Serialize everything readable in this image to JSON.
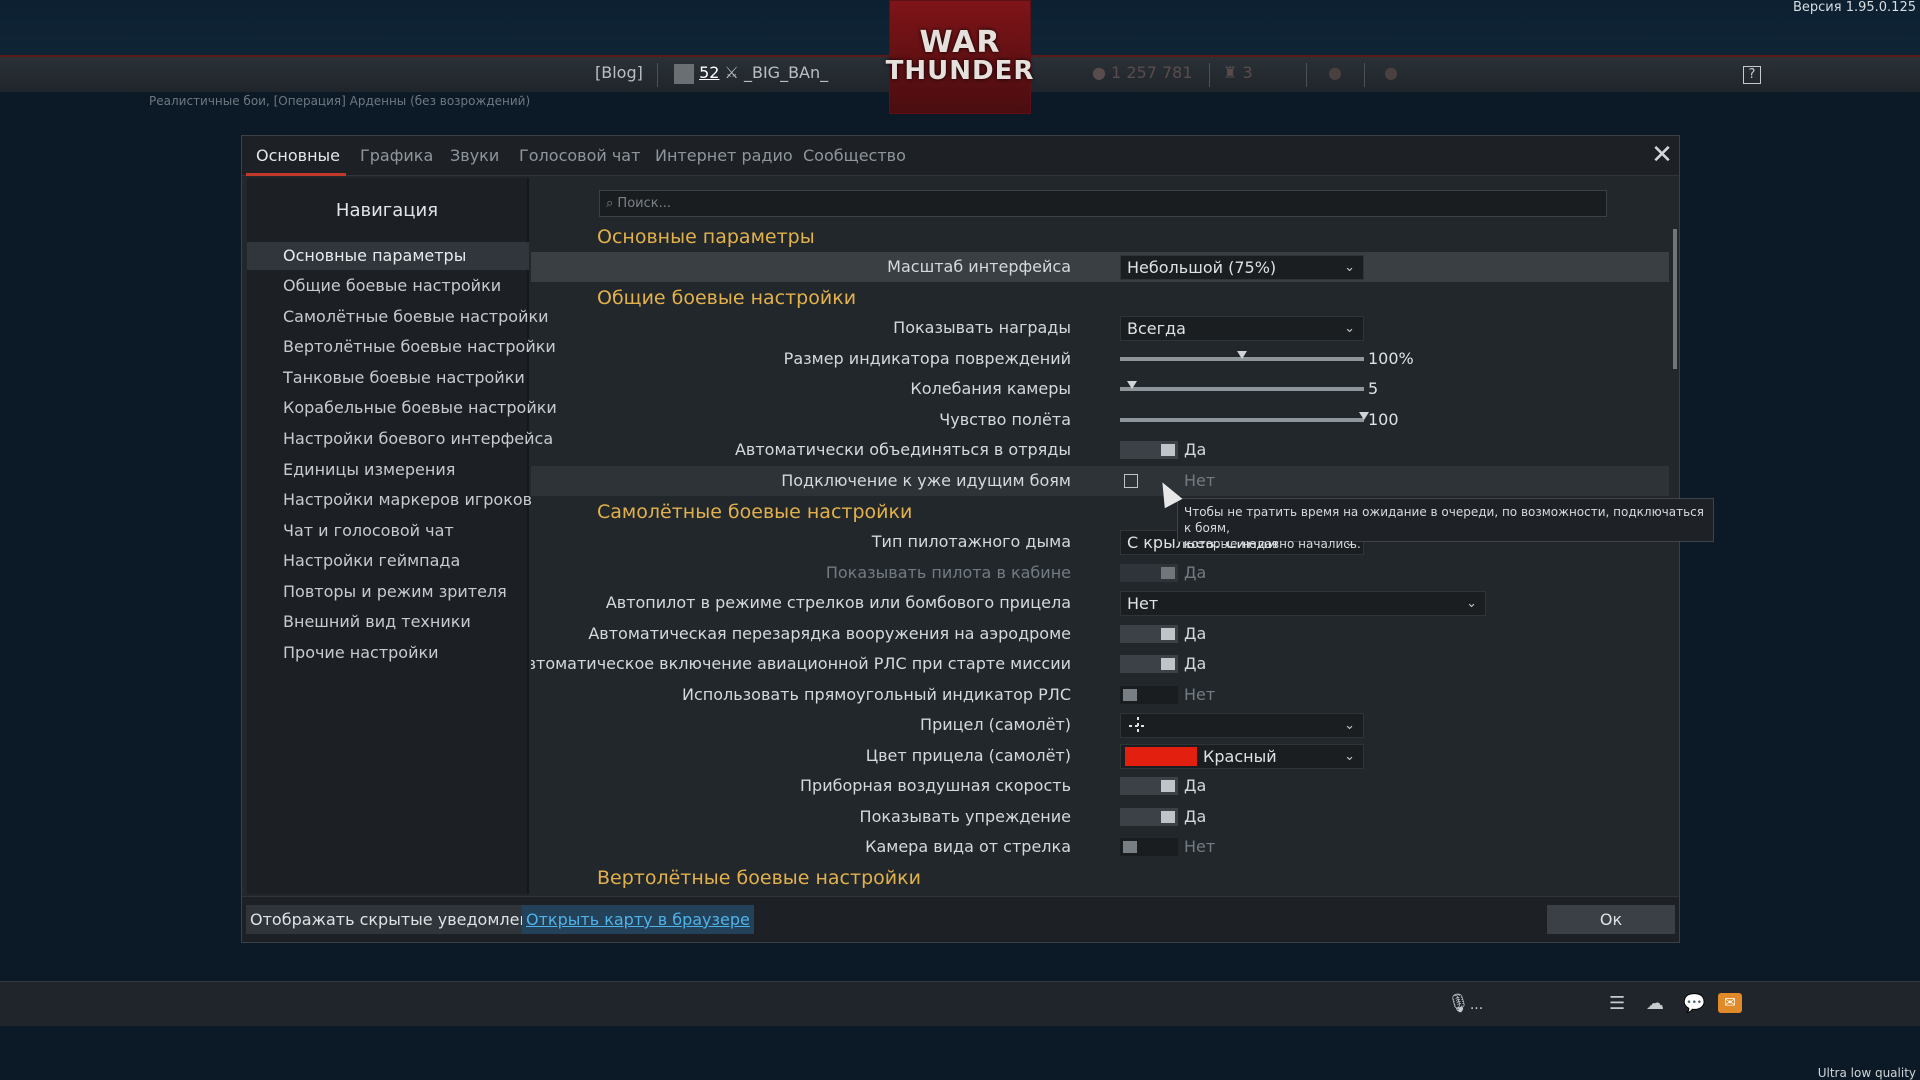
{
  "window": {
    "version": "Версия 1.95.0.125",
    "logo_line1": "WAR",
    "logo_line2": "THUNDER",
    "mission": "Реалистичные бои, [Операция] Арденны (без возрождений)",
    "quality": "Ultra low quality"
  },
  "topbar": {
    "blog": "[Blog]",
    "level": "52",
    "nickname": "_BIG_BAn_",
    "silver": "1 257 781",
    "squadron": "3",
    "help": "?"
  },
  "tabs": [
    {
      "label": "Основные",
      "active": true
    },
    {
      "label": "Графика"
    },
    {
      "label": "Звуки"
    },
    {
      "label": "Голосовой чат"
    },
    {
      "label": "Интернет радио"
    },
    {
      "label": "Сообщество"
    }
  ],
  "nav": {
    "title": "Навигация",
    "items": [
      "Основные параметры",
      "Общие боевые настройки",
      "Самолётные боевые настройки",
      "Вертолётные боевые настройки",
      "Танковые боевые настройки",
      "Корабельные боевые настройки",
      "Настройки боевого интерфейса",
      "Единицы измерения",
      "Настройки маркеров игроков",
      "Чат и голосовой чат",
      "Настройки геймпада",
      "Повторы и режим зрителя",
      "Внешний вид техники",
      "Прочие настройки"
    ]
  },
  "search": {
    "placeholder": "Поиск..."
  },
  "sections": {
    "main": "Основные параметры",
    "combat": "Общие боевые настройки",
    "air": "Самолётные боевые настройки",
    "heli": "Вертолётные боевые настройки"
  },
  "settings": {
    "ui_scale": {
      "label": "Масштаб интерфейса",
      "value": "Небольшой (75%)"
    },
    "show_awards": {
      "label": "Показывать награды",
      "value": "Всегда"
    },
    "damage_indicator": {
      "label": "Размер индикатора повреждений",
      "value": "100%",
      "level": 0.5
    },
    "camera_shake": {
      "label": "Колебания камеры",
      "value": "5",
      "level": 0.05
    },
    "flight_feel": {
      "label": "Чувство полёта",
      "value": "100",
      "level": 1.0
    },
    "auto_squad": {
      "label": "Автоматически объединяться в отряды",
      "value": "Да"
    },
    "join_battles": {
      "label": "Подключение к уже идущим боям",
      "value": "Нет"
    },
    "smoke_type": {
      "label": "Тип пилотажного дыма",
      "value": "С крыльев: Синии"
    },
    "show_pilot": {
      "label": "Показывать пилота в кабине",
      "value": "Да"
    },
    "autopilot": {
      "label": "Автопилот в режиме стрелков или бомбового прицела",
      "value": "Нет"
    },
    "auto_reload": {
      "label": "Автоматическая перезарядка вооружения на аэродроме",
      "value": "Да"
    },
    "auto_radar": {
      "label": "Автоматическое включение авиационной РЛС при старте миссии",
      "value": "Да"
    },
    "rect_radar": {
      "label": "Использовать прямоугольный индикатор РЛС",
      "value": "Нет"
    },
    "crosshair": {
      "label": "Прицел (самолёт)"
    },
    "crosshair_color": {
      "label": "Цвет прицела (самолёт)",
      "value": "Красный",
      "color": "#e3200f"
    },
    "ias": {
      "label": "Приборная воздушная скорость",
      "value": "Да"
    },
    "lead": {
      "label": "Показывать упреждение",
      "value": "Да"
    },
    "gunner_cam": {
      "label": "Камера вида от стрелка",
      "value": "Нет"
    }
  },
  "tooltip": {
    "line1": "Чтобы не тратить время на ожидание в очереди, по возможности, подключаться к боям,",
    "line2": "которые недавно начались."
  },
  "footer": {
    "show_hidden": "Отображать скрытые уведомления",
    "open_map": "Открыть карту в браузере",
    "ok": "Ок"
  },
  "bottombar": {
    "mic": "..."
  },
  "colors": {
    "accent": "#e2b14b",
    "link": "#4fb3e8",
    "tab_active": "#c0392b"
  }
}
